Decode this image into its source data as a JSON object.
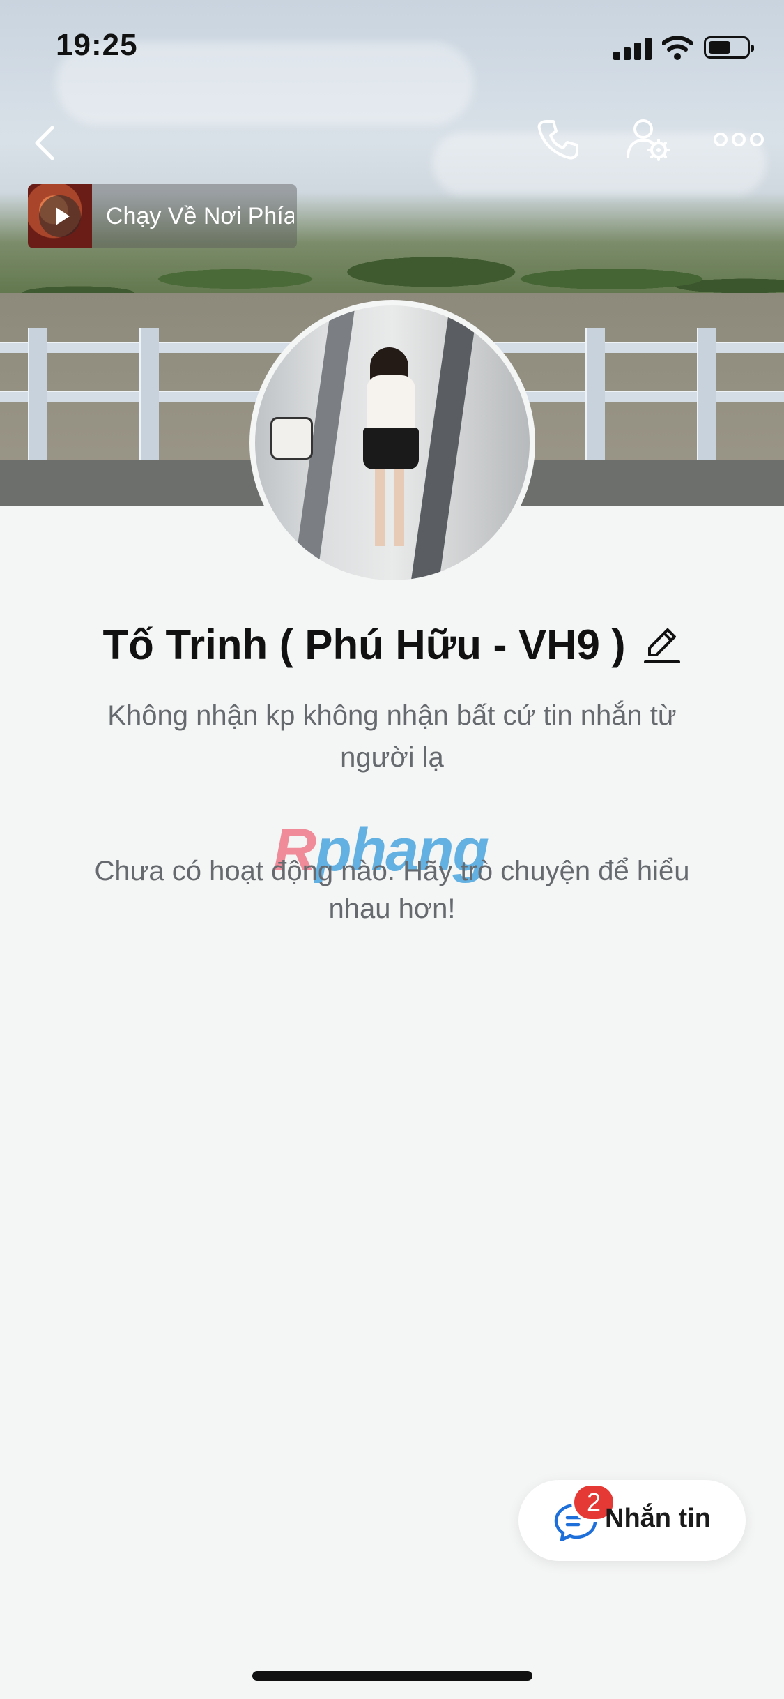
{
  "status_bar": {
    "time": "19:25",
    "signal_icon": "cellular-signal-icon",
    "wifi_icon": "wifi-icon",
    "battery_icon": "battery-icon",
    "battery_level": 0.6
  },
  "nav": {
    "back_icon": "chevron-left-icon",
    "call_icon": "phone-icon",
    "settings_icon": "user-settings-icon",
    "more_icon": "more-horizontal-icon"
  },
  "music": {
    "title": "Chạy Về Nơi Phía Anh",
    "play_icon": "play-icon"
  },
  "profile": {
    "name": "Tố Trinh ( Phú Hữu - VH9 )",
    "edit_icon": "pencil-icon",
    "bio": "Không nhận kp không nhận bất cứ tin nhắn từ người lạ",
    "empty_activity": "Chưa có hoạt động nào. Hãy trò chuyện để hiểu nhau hơn!"
  },
  "watermark": {
    "part1": "R",
    "part2": "phang"
  },
  "message_button": {
    "label": "Nhắn tin",
    "icon": "chat-bubble-icon",
    "badge_count": "2"
  },
  "colors": {
    "background": "#f4f5f5",
    "badge": "#e53935",
    "chat_icon": "#1e6fd9",
    "text_primary": "#111111",
    "text_secondary": "#666a6e"
  }
}
